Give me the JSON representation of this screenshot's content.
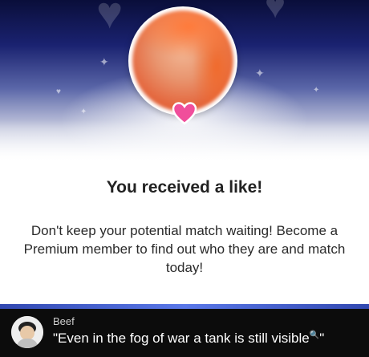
{
  "notification": {
    "title": "You received a like!",
    "message": "Don't keep your potential match waiting! Become a Premium member to find out who they are and match today!",
    "avatar_icon": "profile-photo-blurred",
    "like_icon": "heart-icon",
    "accent_color": "#f04e9b"
  },
  "comment": {
    "username": "Beef",
    "text_main": "\"Even in the fog of war a tank is still visible",
    "text_emoji": "🔍",
    "text_close": "\"",
    "avatar_icon": "user-avatar"
  }
}
